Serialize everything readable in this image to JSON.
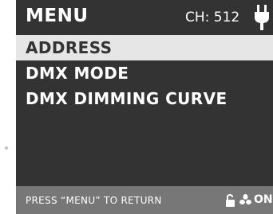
{
  "header": {
    "title": "MENU",
    "channel": "CH: 512",
    "power_icon": "plug-icon"
  },
  "menu": {
    "items": [
      {
        "label": "ADDRESS",
        "selected": true
      },
      {
        "label": "DMX MODE",
        "selected": false
      },
      {
        "label": "DMX DIMMING CURVE",
        "selected": false
      }
    ]
  },
  "footer": {
    "hint": "PRESS “MENU” TO RETURN",
    "lock_icon": "unlocked-padlock-icon",
    "fan_icon": "fan-icon",
    "fan_status": "ON"
  },
  "colors": {
    "screen_background": "#333333",
    "selected_row": "#e6e6e6",
    "footer_bar": "#777777",
    "text": "#ffffff"
  }
}
